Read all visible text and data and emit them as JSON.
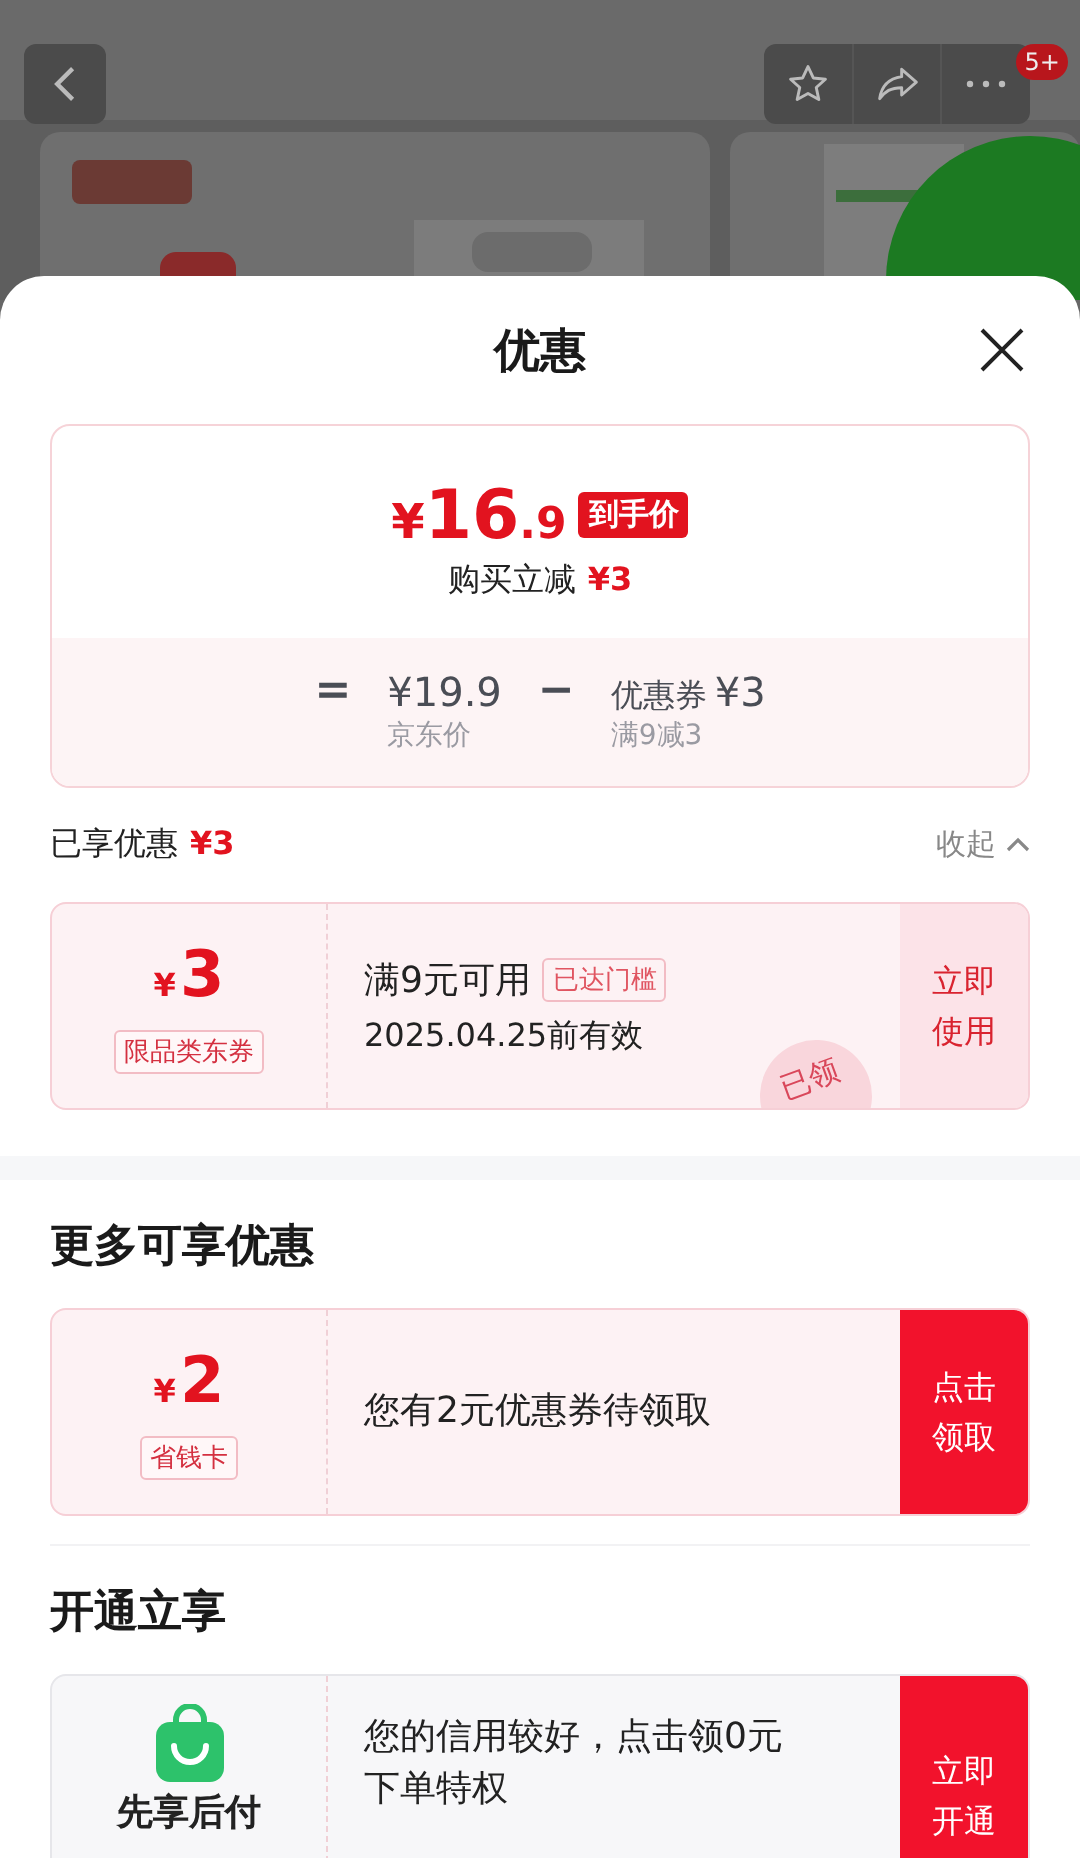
{
  "top_bar": {
    "badge": "5+"
  },
  "sheet": {
    "title": "优惠"
  },
  "price_summary": {
    "currency": "¥",
    "final_int": "16",
    "final_dec": ".9",
    "price_tag": "到手价",
    "saving_label": "购买立减",
    "saving_amount": "¥3",
    "breakdown": [
      {
        "kind": "operator",
        "text": "="
      },
      {
        "kind": "price",
        "amount": "¥19.9",
        "caption": "京东价"
      },
      {
        "kind": "operator",
        "text": "−"
      },
      {
        "kind": "discount",
        "label": "优惠券",
        "amount": "¥3",
        "caption": "满9减3"
      }
    ]
  },
  "applied": {
    "label": "已享优惠",
    "amount": "¥3",
    "toggle": "收起",
    "expanded": true
  },
  "applied_coupons": [
    {
      "kind": "coupon",
      "currency": "¥",
      "amount": "3",
      "tag": "限品类东券",
      "condition": "满9元可用",
      "status_tag": "已达门槛",
      "validity": "2025.04.25前有效",
      "action": "立即使用",
      "stamp": "已领"
    }
  ],
  "sections": [
    {
      "title": "更多可享优惠",
      "items": [
        {
          "kind": "coupon",
          "currency": "¥",
          "amount": "2",
          "tag": "省钱卡",
          "text": "您有2元优惠券待领取",
          "action": "点击领取"
        }
      ]
    },
    {
      "title": "开通立享",
      "items": [
        {
          "kind": "service",
          "name": "先享后付",
          "text": "您的信用较好，点击领0元下单特权",
          "action": "立即开通"
        }
      ]
    }
  ]
}
